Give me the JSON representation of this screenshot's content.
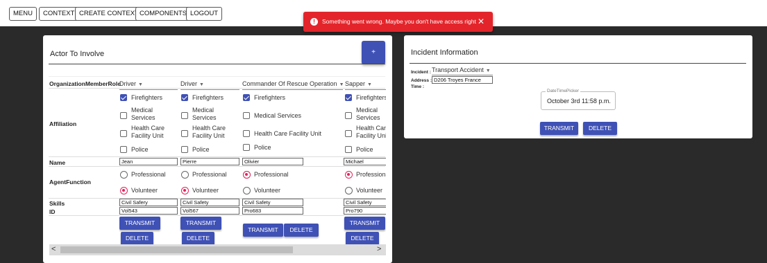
{
  "nav": {
    "menu": "MENU",
    "context": "CONTEXT",
    "create_context": "CREATE CONTEXT",
    "components": "COMPONENTS",
    "logout": "LOGOUT"
  },
  "toast": {
    "message": "Something went wrong. Maybe you don't have access right",
    "close": "✕",
    "color": "#e3252b"
  },
  "actor_card": {
    "title": "Actor To Involve",
    "add_button": "+",
    "header_label": "OrganizationMemberRole",
    "affiliation_label": "Affiliation",
    "name_label": "Name",
    "agent_function_label": "AgentFunction",
    "skills_label": "Skills",
    "id_label": "ID",
    "affiliation_options": [
      "Firefighters",
      "Medical Services",
      "Health Care Facility Unit",
      "Police"
    ],
    "function_options": [
      "Professional",
      "Volunteer"
    ],
    "columns": [
      {
        "role": "Driver",
        "affiliation_checked": [
          true,
          false,
          false,
          false
        ],
        "name": "Jean",
        "function": "Volunteer",
        "skills": "Civil Safery",
        "id": "Vol543",
        "transmit": "TRANSMIT",
        "delete": "DELETE"
      },
      {
        "role": "Driver",
        "affiliation_checked": [
          true,
          false,
          false,
          false
        ],
        "name": "Pierre",
        "function": "Volunteer",
        "skills": "Civil Safety",
        "id": "Vol567",
        "transmit": "TRANSMIT",
        "delete": "DELETE"
      },
      {
        "role": "Commander Of Rescue Operation",
        "affiliation_checked": [
          true,
          false,
          false,
          false
        ],
        "name": "Olivier",
        "function": "Professional",
        "skills": "Civil Safety",
        "id": "Pro683",
        "transmit": "TRANSMIT",
        "delete": "DELETE"
      },
      {
        "role": "Sapper",
        "affiliation_checked": [
          true,
          false,
          false,
          false
        ],
        "name": "Michael",
        "function": "Professional",
        "skills": "Civil Safety",
        "id": "Pro790",
        "transmit": "TRANSMIT",
        "delete": "DELETE"
      }
    ],
    "scroll_left": "<",
    "scroll_right": ">"
  },
  "incident_card": {
    "title": "Incident Information",
    "incident_label": "Incident :",
    "incident_value": "Transport Accident",
    "address_label": "Address :",
    "address_value": "D206 Troyes France",
    "time_label": "Time :",
    "datetime_label": "DateTimePicker",
    "datetime_value": "October 3rd 11:58 p.m.",
    "transmit": "TRANSMIT",
    "delete": "DELETE"
  },
  "colors": {
    "primary": "#3f51b5",
    "radio_accent": "#e8215b",
    "dark_background": "#2a2a2a"
  }
}
